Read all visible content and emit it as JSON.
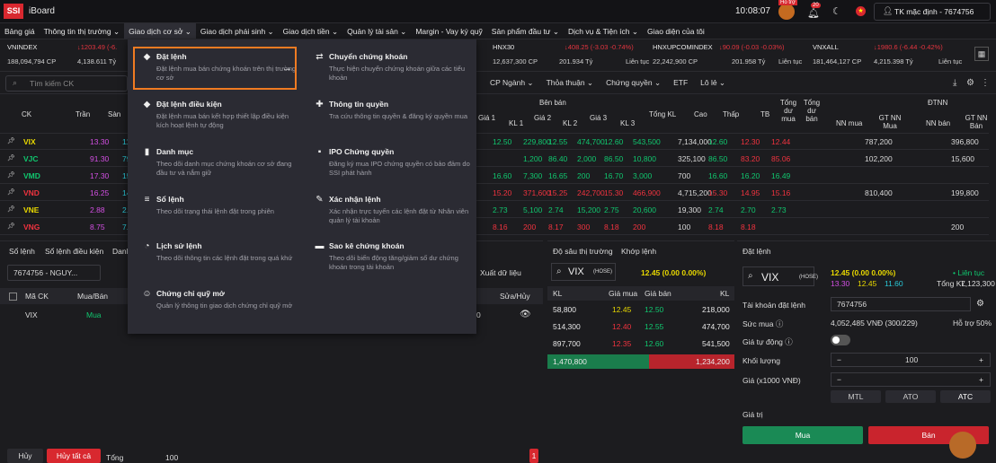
{
  "app": {
    "logo": "SSI",
    "name": "iBoard",
    "time": "10:08:07",
    "notif_count": "20",
    "help_badge": "Hỗ trợ",
    "account": "TK mặc định - 7674756"
  },
  "menu": [
    "Bảng giá",
    "Thông tin thị trường ⌄",
    "Giao dịch cơ sở ⌄",
    "Giao dịch phái sinh ⌄",
    "Giao dịch tiền ⌄",
    "Quản lý tài sản ⌄",
    "Margin - Vay ký quỹ",
    "Sản phẩm đầu tư ⌄",
    "Dịch vụ & Tiện ích ⌄",
    "Giao diện của tôi"
  ],
  "indices": [
    {
      "name": "VNINDEX",
      "change": "↓1203.49 (-6.",
      "vol": "188,094,794 CP",
      "val": "4,138.611 Tỷ",
      "status": ""
    },
    {
      "name": "HNX30",
      "change": "↓408.25 (-3.03 -0.74%)",
      "vol": "12,637,300 CP",
      "val": "201.934 Tỷ",
      "status": "Liên tục"
    },
    {
      "name": "HNXUPCOMINDEX",
      "change": "↓90.09 (-0.03 -0.03%)",
      "vol": "22,242,900 CP",
      "val": "201.958 Tỷ",
      "status": "Liên tục"
    },
    {
      "name": "VNXALL",
      "change": "↓1980.6 (-6.44 -0.42%)",
      "vol": "181,464,127 CP",
      "val": "4,215.398 Tỷ",
      "status": "Liên tục"
    }
  ],
  "search": {
    "placeholder": "Tìm kiếm CK"
  },
  "filters": [
    "CP Ngành ⌄",
    "Thỏa thuận ⌄",
    "Chứng quyền ⌄",
    "ETF",
    "Lô lẻ ⌄"
  ],
  "board": {
    "headers": {
      "ck": "CK",
      "tran": "Trần",
      "san": "Sàn",
      "ban": "Bên bán",
      "gia1": "Giá 1",
      "kl1": "KL 1",
      "gia2": "Giá 2",
      "kl2": "KL 2",
      "gia3": "Giá 3",
      "kl3": "KL 3",
      "tongkl": "Tổng KL",
      "cao": "Cao",
      "thap": "Thấp",
      "tb": "TB",
      "tongmua": "Tổng dư mua",
      "tongban": "Tổng dư bán",
      "dtnn": "ĐTNN",
      "nnmua": "NN mua",
      "gtnnmua": "GT NN Mua",
      "nnban": "NN bán",
      "gtnnban": "GT NN Bán"
    },
    "rows": [
      {
        "ck": "VIX",
        "tran": "13.30",
        "san": "11.60",
        "g1": "12.50",
        "k1": "229,800",
        "g2": "12.55",
        "k2": "474,700",
        "g3": "12.60",
        "k3": "543,500",
        "tkl": "7,134,000",
        "cao": "12.60",
        "thap": "12.30",
        "tb": "12.44",
        "nnm": "787,200",
        "nnb": "396,800"
      },
      {
        "ck": "VJC",
        "tran": "91.30",
        "san": "79.50",
        "g1": "",
        "k1": "1,200",
        "g2": "86.40",
        "k2": "2,000",
        "g3": "86.50",
        "k3": "10,800",
        "tkl": "325,100",
        "cao": "86.50",
        "thap": "83.20",
        "tb": "85.06",
        "nnm": "102,200",
        "nnb": "15,600"
      },
      {
        "ck": "VMD",
        "tran": "17.30",
        "san": "15.10",
        "g1": "16.60",
        "k1": "7,300",
        "g2": "16.65",
        "k2": "200",
        "g3": "16.70",
        "k3": "3,000",
        "tkl": "700",
        "cao": "16.60",
        "thap": "16.20",
        "tb": "16.49",
        "nnm": "",
        "nnb": ""
      },
      {
        "ck": "VND",
        "tran": "16.25",
        "san": "14.15",
        "g1": "15.20",
        "k1": "371,600",
        "g2": "15.25",
        "k2": "242,700",
        "g3": "15.30",
        "k3": "466,900",
        "tkl": "4,715,200",
        "cao": "15.30",
        "thap": "14.95",
        "tb": "15.16",
        "nnm": "810,400",
        "nnb": "199,800"
      },
      {
        "ck": "VNE",
        "tran": "2.88",
        "san": "2.52",
        "g1": "2.73",
        "k1": "5,100",
        "g2": "2.74",
        "k2": "15,200",
        "g3": "2.75",
        "k3": "20,600",
        "tkl": "19,300",
        "cao": "2.74",
        "thap": "2.70",
        "tb": "2.73",
        "nnm": "",
        "nnb": ""
      },
      {
        "ck": "VNG",
        "tran": "8.75",
        "san": "7.61",
        "g1": "8.16",
        "k1": "200",
        "g2": "8.17",
        "k2": "300",
        "g3": "8.18",
        "k3": "200",
        "tkl": "100",
        "cao": "8.18",
        "thap": "8.18",
        "tb": "",
        "nnm": "",
        "nnb": "200"
      }
    ]
  },
  "dropdown": {
    "items": [
      {
        "title": "Đặt lệnh",
        "desc": "Đặt lệnh mua bán chứng khoán trên thị trường cơ sở",
        "icon": "◆"
      },
      {
        "title": "Chuyển chứng khoán",
        "desc": "Thực hiện chuyển chứng khoán giữa các tiểu khoản",
        "icon": "⇄"
      },
      {
        "title": "Đặt lệnh điều kiện",
        "desc": "Đặt lệnh mua bán kết hợp thiết lập điều kiện kích hoạt lệnh tự động",
        "icon": "◆"
      },
      {
        "title": "Thông tin quyền",
        "desc": "Tra cứu thông tin quyền & đăng ký quyền mua",
        "icon": "✚"
      },
      {
        "title": "Danh mục",
        "desc": "Theo dõi danh mục chứng khoán cơ sở đang đầu tư và nắm giữ",
        "icon": "▮"
      },
      {
        "title": "IPO Chứng quyền",
        "desc": "Đăng ký mua IPO chứng quyền có bảo đảm do SSI phát hành",
        "icon": "▪"
      },
      {
        "title": "Sổ lệnh",
        "desc": "Theo dõi trạng thái lệnh đặt trong phiên",
        "icon": "≡"
      },
      {
        "title": "Xác nhận lệnh",
        "desc": "Xác nhận trực tuyến các lệnh đặt từ Nhân viên quản lý tài khoản",
        "icon": "✎"
      },
      {
        "title": "Lịch sử lệnh",
        "desc": "Theo dõi thông tin các lệnh đặt trong quá khứ",
        "icon": "◔"
      },
      {
        "title": "Sao kê chứng khoán",
        "desc": "Theo dõi biến động tăng/giảm số dư chứng khoán trong tài khoản",
        "icon": "▬"
      },
      {
        "title": "Chứng chỉ quỹ mở",
        "desc": "Quản lý thông tin giao dịch chứng chỉ quỹ mở",
        "icon": "☺"
      }
    ],
    "arrow": "→"
  },
  "orderbook": {
    "tabs": [
      "Sổ lệnh",
      "Sổ lệnh điều kiện",
      "Danh"
    ],
    "account": "7674756 - NGUY...",
    "export": "Xuất dữ liệu",
    "cols": {
      "mack": "Mã CK",
      "side": "Mua/Bán",
      "edit": "Sửa/Hủy"
    },
    "row": {
      "ck": "VIX",
      "side": "Mua",
      "qty": "0"
    },
    "cancel": "Hủy",
    "cancel_all": "Hủy tất cả",
    "total_label": "Tổng",
    "total": "100",
    "page": "1"
  },
  "depth": {
    "tabs": [
      "Độ sâu thị trường",
      "Khớp lệnh"
    ],
    "symbol": "VIX",
    "exch": "(HOSE)",
    "price": "12.45 (0.00 0.00%)",
    "cols": [
      "KL",
      "Giá mua",
      "Giá bán",
      "KL"
    ],
    "rows": [
      [
        "58,800",
        "12.45",
        "12.50",
        "218,000"
      ],
      [
        "514,300",
        "12.40",
        "12.55",
        "474,700"
      ],
      [
        "897,700",
        "12.35",
        "12.60",
        "541,500"
      ]
    ],
    "buy_total": "1,470,800",
    "sell_total": "1,234,200"
  },
  "order": {
    "tab": "Đặt lệnh",
    "symbol": "VIX",
    "exch": "(HOSE)",
    "price": "12.45 (0.00 0.00%)",
    "ceil": "13.30",
    "ref": "12.45",
    "floor": "11.60",
    "status": "• Liên tục",
    "total_label": "Tổng KL",
    "total": "7,123,300",
    "acct_label": "Tài khoản đặt lệnh",
    "acct": "7674756",
    "buy_power_label": "Sức mua ⓘ",
    "buy_power": "4,052,485 VNĐ (300/229)",
    "margin_label": "Hỗ trợ",
    "margin": "50%",
    "auto_label": "Giá tự động ⓘ",
    "qty_label": "Khối lượng",
    "qty": "100",
    "price_label": "Giá (x1000 VNĐ)",
    "types": [
      "MTL",
      "ATO",
      "ATC"
    ],
    "value_label": "Giá trị",
    "buy": "Mua",
    "sell": "Bán"
  }
}
